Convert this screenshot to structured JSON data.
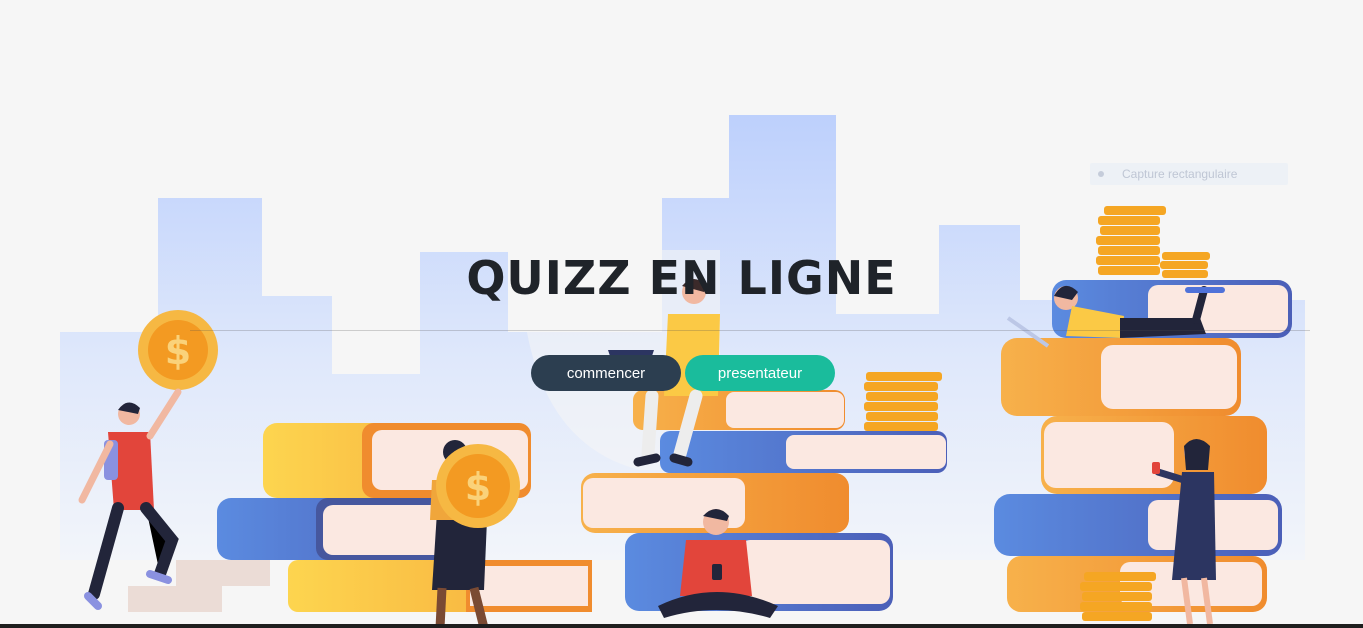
{
  "hero": {
    "title": "QUIZZ EN LIGNE"
  },
  "actions": {
    "start_label": "commencer",
    "presenter_label": "presentateur"
  },
  "tooltip": {
    "label": "Capture rectangulaire"
  },
  "colors": {
    "background": "#f6f6f6",
    "title": "#1f2329",
    "start_button": "#2c3e50",
    "presenter_button": "#1abc9c",
    "buildings": "#c3d3fb",
    "book_orange": "#f5a03d",
    "book_blue": "#4f72d9",
    "book_yellow": "#fbcb4a",
    "coin": "#f5a623"
  },
  "icons": [
    "dollar-coin-icon",
    "dollar-coin-icon",
    "coin-stack-icon"
  ]
}
